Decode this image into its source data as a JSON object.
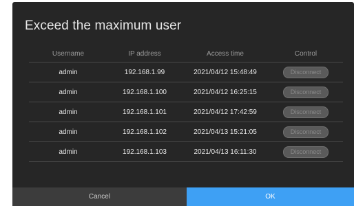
{
  "dialog": {
    "title": "Exceed the maximum user",
    "columns": [
      "Username",
      "IP address",
      "Access time",
      "Control"
    ],
    "rows": [
      {
        "username": "admin",
        "ip": "192.168.1.99",
        "time": "2021/04/12 15:48:49",
        "control": "Disconnect"
      },
      {
        "username": "admin",
        "ip": "192.168.1.100",
        "time": "2021/04/12 16:25:15",
        "control": "Disconnect"
      },
      {
        "username": "admin",
        "ip": "192.168.1.101",
        "time": "2021/04/12 17:42:59",
        "control": "Disconnect"
      },
      {
        "username": "admin",
        "ip": "192.168.1.102",
        "time": "2021/04/13 15:21:05",
        "control": "Disconnect"
      },
      {
        "username": "admin",
        "ip": "192.168.1.103",
        "time": "2021/04/13 16:11:30",
        "control": "Disconnect"
      }
    ],
    "cancel_label": "Cancel",
    "ok_label": "OK"
  },
  "colors": {
    "dialog_bg": "#262626",
    "ok_accent": "#3ea0f4",
    "cancel_bg": "#3c3c3c"
  }
}
